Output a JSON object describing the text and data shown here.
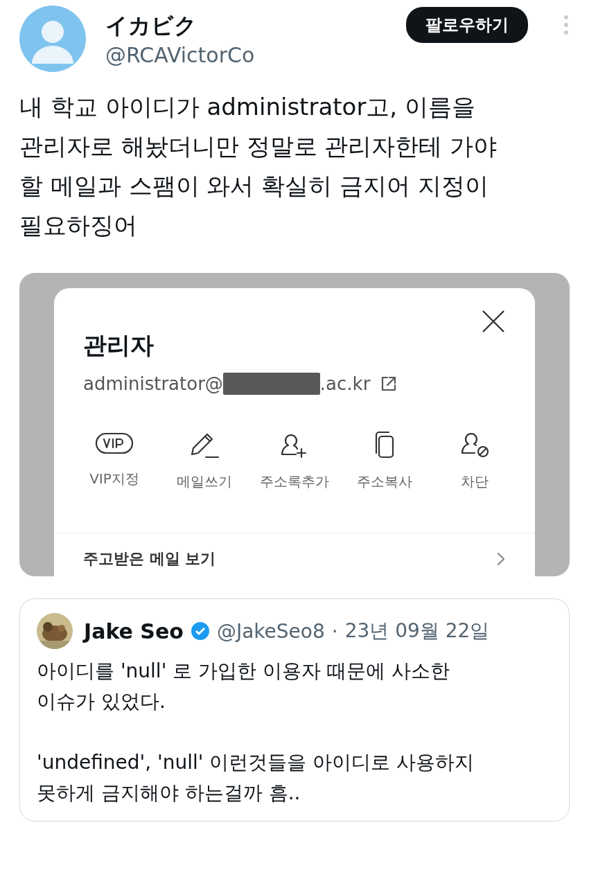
{
  "author": {
    "name": "イカビク",
    "handle": "@RCAVictorCo"
  },
  "follow_button": "팔로우하기",
  "tweet_text": "내 학교 아이디가 administrator고, 이름을\n관리자로 해놨더니만 정말로 관리자한테 가야\n할 메일과 스팸이 와서 확실히 금지어 지정이\n필요하징어",
  "screenshot": {
    "contact_name": "관리자",
    "email_prefix": "administrator@",
    "email_suffix": ".ac.kr",
    "actions": [
      {
        "kind": "vip",
        "label": "VIP지정"
      },
      {
        "kind": "write",
        "label": "메일쓰기"
      },
      {
        "kind": "add_contact",
        "label": "주소록추가"
      },
      {
        "kind": "copy",
        "label": "주소복사"
      },
      {
        "kind": "block",
        "label": "차단"
      }
    ],
    "list_item": "주고받은 메일 보기"
  },
  "quote": {
    "name": "Jake Seo",
    "verified": true,
    "handle": "@JakeSeo8",
    "separator": "·",
    "date": "23년 09월 22일",
    "paragraphs": [
      "아이디를 'null' 로 가입한 이용자 때문에 사소한\n이슈가 있었다.",
      "'undefined', 'null' 이런것들을 아이디로 사용하지\n못하게 금지해야 하는걸까 흠.."
    ]
  }
}
